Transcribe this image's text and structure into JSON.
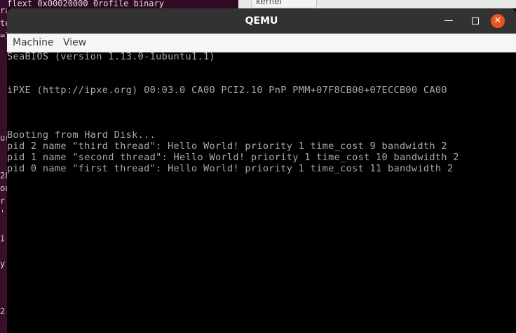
{
  "background": {
    "left_fragments": [
      "ra",
      "te",
      "=1",
      "ur",
      "ou",
      "r",
      "'",
      "28",
      "i",
      "y",
      "2"
    ],
    "top_terminal_text": "flext 0x00020000  0rofile binary",
    "top_tab_label": "kernel"
  },
  "window": {
    "title": "QEMU",
    "minimize_symbol": "—",
    "close_symbol": "✕"
  },
  "menu": {
    "items": [
      "Machine",
      "View"
    ]
  },
  "console": {
    "lines": [
      "SeaBIOS (version 1.13.0-1ubuntu1.1)",
      "",
      "",
      "iPXE (http://ipxe.org) 00:03.0 CA00 PCI2.10 PnP PMM+07F8CB00+07ECCB00 CA00",
      "",
      "",
      "",
      "Booting from Hard Disk...",
      "pid 2 name \"third thread\": Hello World! priority 1 time_cost 9 bandwidth 2",
      "pid 1 name \"second thread\": Hello World! priority 1 time_cost 10 bandwidth 2",
      "pid 0 name \"first thread\": Hello World! priority 1 time_cost 11 bandwidth 2"
    ]
  },
  "colors": {
    "console_text": "#aaaaaa",
    "titlebar": "#323232",
    "close_button": "#e95420"
  }
}
